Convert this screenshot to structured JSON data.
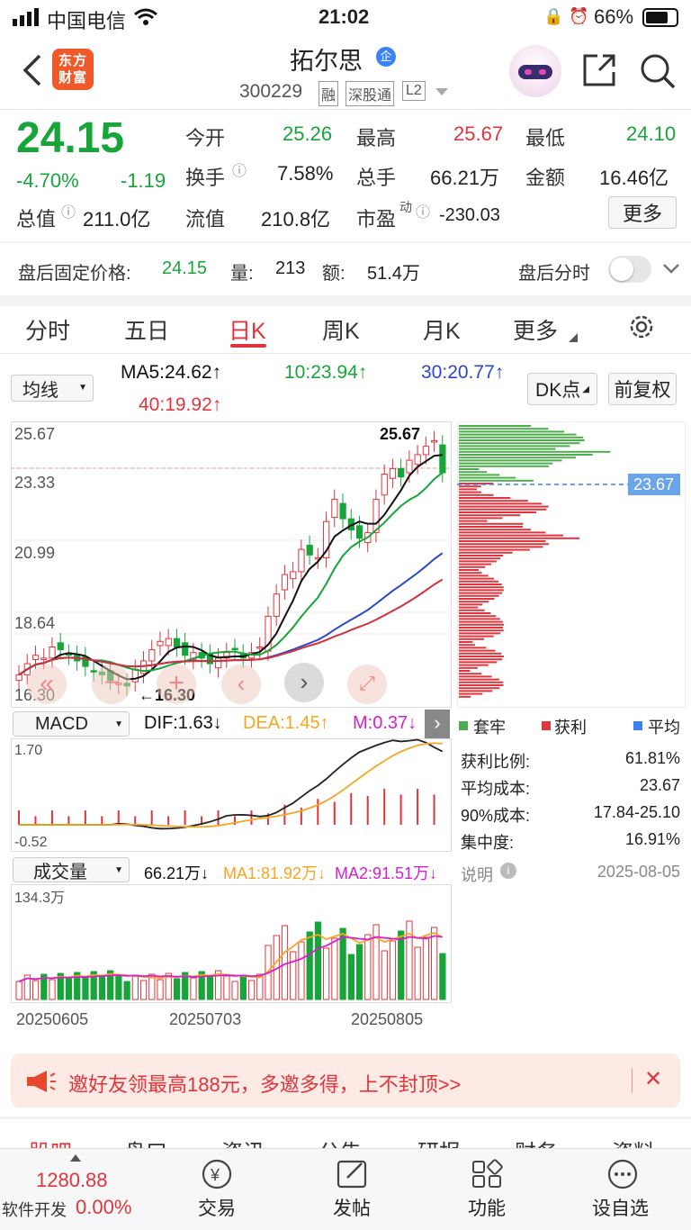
{
  "status": {
    "carrier": "中国电信",
    "time": "21:02",
    "battery": "66%"
  },
  "header": {
    "app_logo": "东方财富",
    "stock_name": "拓尔思",
    "stock_tag": "企",
    "stock_code": "300229",
    "badges": [
      "融",
      "深股通",
      "L2"
    ]
  },
  "quote": {
    "price": "24.15",
    "change_pct": "-4.70%",
    "change": "-1.19",
    "open_label": "今开",
    "open": "25.26",
    "high_label": "最高",
    "high": "25.67",
    "low_label": "最低",
    "low": "24.10",
    "turnover_label": "换手",
    "turnover": "7.58%",
    "volume_label": "总手",
    "volume": "66.21万",
    "amount_label": "金额",
    "amount": "16.46亿",
    "mcap_label": "总值",
    "mcap": "211.0亿",
    "float_label": "流值",
    "float": "210.8亿",
    "pe_label": "市盈",
    "pe_sup": "动",
    "pe": "-230.03",
    "more": "更多"
  },
  "after": {
    "label": "盘后固定价格:",
    "price": "24.15",
    "vol_label": "量:",
    "vol": "213",
    "amt_label": "额:",
    "amt": "51.4万",
    "minute_label": "盘后分时"
  },
  "tabs": [
    "分时",
    "五日",
    "日K",
    "周K",
    "月K",
    "更多"
  ],
  "ma": {
    "select": "均线",
    "ma5": "MA5:24.62↑",
    "ma10": "10:23.94↑",
    "ma30": "30:20.77↑",
    "ma40": "40:19.92↑",
    "dk": "DK点",
    "fq": "前复权"
  },
  "kchart": {
    "y_labels": [
      "25.67",
      "23.33",
      "20.99",
      "18.64",
      "16.30"
    ],
    "hi_label": "25.67",
    "lo_label": "←16.30",
    "avg_cost_tag": "23.67"
  },
  "macd": {
    "select": "MACD",
    "dif": "DIF:1.63↓",
    "dea": "DEA:1.45↑",
    "m": "M:0.37↓",
    "y_top": "1.70",
    "y_bot": "-0.52"
  },
  "vol": {
    "select": "成交量",
    "v": "66.21万↓",
    "ma1": "MA1:81.92万↓",
    "ma2": "MA2:91.51万↓",
    "y_top": "134.3万",
    "dates": [
      "20250605",
      "20250703",
      "20250805"
    ]
  },
  "chips": {
    "legend": [
      "套牢",
      "获利",
      "平均"
    ],
    "rows": [
      [
        "获利比例:",
        "61.81%"
      ],
      [
        "平均成本:",
        "23.67"
      ],
      [
        "90%成本:",
        "17.84-25.10"
      ],
      [
        "集中度:",
        "16.91%"
      ]
    ],
    "note": "说明",
    "date": "2025-08-05"
  },
  "promo": {
    "text": "邀好友领最高188元，多邀多得，上不封顶>>"
  },
  "subtabs": [
    "股吧",
    "盘口",
    "资讯",
    "公告",
    "研报",
    "财务",
    "资料"
  ],
  "bottom": {
    "index": "1280.88",
    "index_name": "软件开发",
    "index_pct": "0.00%",
    "items": [
      "交易",
      "发帖",
      "功能",
      "设自选"
    ]
  },
  "chart_data": {
    "type": "candlestick",
    "ylim": [
      16.3,
      25.67
    ],
    "closes": [
      16.9,
      17.3,
      17.6,
      17.5,
      17.9,
      17.8,
      17.6,
      17.4,
      17.2,
      17.0,
      16.9,
      16.7,
      16.6,
      16.5,
      17.1,
      17.4,
      17.8,
      18.1,
      18.2,
      17.9,
      17.6,
      17.7,
      17.5,
      17.3,
      17.5,
      17.7,
      17.8,
      17.5,
      17.7,
      17.9,
      19.0,
      19.8,
      20.5,
      20.6,
      21.4,
      21.2,
      21.1,
      22.4,
      23.2,
      22.5,
      22.1,
      21.8,
      22.0,
      23.2,
      24.1,
      24.3,
      24.0,
      24.6,
      24.8,
      25.1,
      25.3,
      24.15
    ]
  }
}
